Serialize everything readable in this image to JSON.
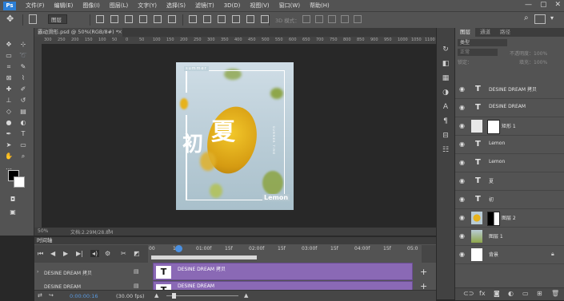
{
  "menu": {
    "logo": "Ps",
    "items": [
      "文件(F)",
      "编辑(E)",
      "图像(I)",
      "图层(L)",
      "文字(Y)",
      "选择(S)",
      "滤镜(T)",
      "3D(D)",
      "视图(V)",
      "窗口(W)",
      "帮助(H)"
    ]
  },
  "window_controls": {
    "minimize": "—",
    "maximize": "▢",
    "close": "✕"
  },
  "options": {
    "auto_select": "图层",
    "mode_3d": "3D 模式："
  },
  "document": {
    "tab_title": "霸动滑形.psd @ 50%(RGB/8#) *",
    "zoom": "50%",
    "doc_size": "文档:2.29M/28.8M",
    "ruler_marks": [
      "300",
      "250",
      "200",
      "150",
      "100",
      "50",
      "0",
      "50",
      "100",
      "150",
      "200",
      "250",
      "300",
      "350",
      "400",
      "450",
      "500",
      "550",
      "600",
      "650",
      "700",
      "750",
      "800",
      "850",
      "900",
      "950",
      "1000",
      "1050",
      "1100"
    ]
  },
  "artwork": {
    "top_label": "summer",
    "char1": "初",
    "char2": "夏",
    "side_text": "SUMMER TIME",
    "bottom_label": "Lemon",
    "colors": {
      "lemon": "#e6b21c",
      "lime": "#8ea64a",
      "bg": "#c3d5de"
    }
  },
  "layers_panel": {
    "tabs": [
      "图层",
      "通道",
      "路径"
    ],
    "kind_label": "类型",
    "blend_mode": "正常",
    "opacity_label": "不透明度：100%",
    "lock_label": "锁定：",
    "fill_label": "填充：100%",
    "layers": [
      {
        "name": "DESINE DREAM 拷贝",
        "type": "text"
      },
      {
        "name": "DESINE DREAM",
        "type": "text"
      },
      {
        "name": "矩形 1",
        "type": "shape"
      },
      {
        "name": "Lemon",
        "type": "text"
      },
      {
        "name": "Lemon",
        "type": "text"
      },
      {
        "name": "夏",
        "type": "text"
      },
      {
        "name": "初",
        "type": "text"
      },
      {
        "name": "图层 2",
        "type": "image"
      },
      {
        "name": "图层 1",
        "type": "image"
      },
      {
        "name": "背景",
        "type": "background"
      }
    ]
  },
  "timeline": {
    "tab": "时间轴",
    "ticks": [
      "00",
      "15f",
      "01:00f",
      "15f",
      "02:00f",
      "15f",
      "03:00f",
      "15f",
      "04:00f",
      "15f",
      "05:0"
    ],
    "tracks": [
      {
        "name": "DESINE DREAM 拷贝",
        "clip_label": "DESINE DREAM 拷贝",
        "thumb": "T"
      },
      {
        "name": "DESINE DREAM",
        "clip_label": "DESINE DREAM",
        "thumb": "T"
      }
    ],
    "current_time": "0:00:00:16",
    "fps": "(30.00 fps)"
  }
}
